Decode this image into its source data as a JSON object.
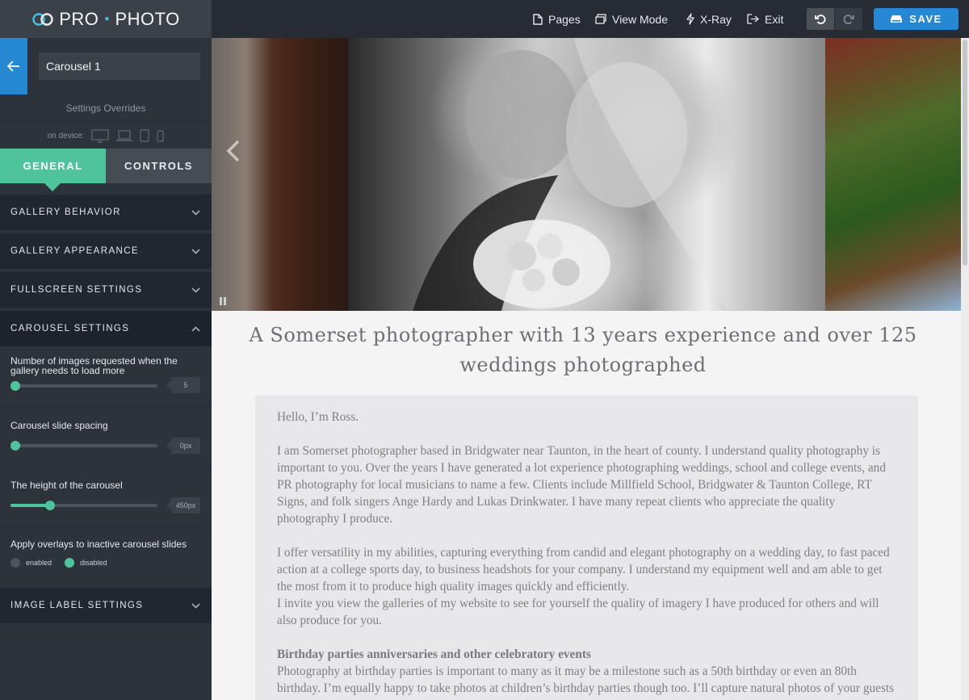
{
  "app": {
    "brand_left": "PRO",
    "brand_right": "PHOTO"
  },
  "toolbar": {
    "pages": "Pages",
    "view_mode": "View Mode",
    "xray": "X-Ray",
    "exit": "Exit",
    "save": "SAVE"
  },
  "sidebar": {
    "element_name": "Carousel 1",
    "settings_overrides": "Settings Overrides",
    "on_device": "on device:",
    "tabs": [
      "GENERAL",
      "CONTROLS"
    ],
    "sections": {
      "behavior": "GALLERY BEHAVIOR",
      "appearance": "GALLERY APPEARANCE",
      "fullscreen": "FULLSCREEN SETTINGS",
      "carousel": "CAROUSEL SETTINGS",
      "image_label": "IMAGE LABEL SETTINGS"
    },
    "controls": {
      "images_requested": {
        "label": "Number of images requested when the gallery needs to load more",
        "value": "5",
        "fraction": 0.0
      },
      "slide_spacing": {
        "label": "Carousel slide spacing",
        "value": "0px",
        "fraction": 0.0
      },
      "carousel_height": {
        "label": "The height of the carousel",
        "value": "450px",
        "fraction": 0.27
      },
      "overlays": {
        "label": "Apply overlays to inactive carousel slides",
        "option_enabled": "enabled",
        "option_disabled": "disabled",
        "selected": "disabled"
      }
    }
  },
  "preview": {
    "title": "A Somerset photographer with 13 years experience and over 125 weddings photographed",
    "paragraphs": [
      "Hello, I’m Ross.",
      "I am Somerset photographer based in Bridgwater  near Taunton, in the heart of county.  I understand quality photography is important to you.  Over the years I have generated a lot experience photographing weddings, school and college events, and PR photography for local musicians to name a few.  Clients include Millfield School, Bridgwater & Taunton College, RT Signs, and folk singers Ange Hardy and Lukas Drinkwater.  I have many repeat clients who appreciate the quality photography I produce.",
      "I offer versatility in my abilities, capturing everything from candid and elegant photography on a wedding day, to fast paced action at a college sports day, to business headshots for your company.  I understand my equipment well and am able to get the most from it to produce high quality images quickly and efficiently.",
      "I invite you view the galleries of my website to see for yourself the quality of imagery I have produced for others and will also produce for you."
    ],
    "subheading": "Birthday parties anniversaries and other celebratory events",
    "subparagraph": "Photography at birthday parties is important to many as it may be a milestone such as a 50th birthday or even an 80th birthday.  I’m equally happy to take photos at children’s birthday parties though too.  I’ll capture natural photos of your guests having fun.  You can use them for a personal record of the event, or for sharing on social media."
  },
  "colors": {
    "accent_green": "#4fc49c",
    "accent_blue": "#2688d2",
    "sidebar_bg": "#2d333b",
    "topbar_bg": "#272c34"
  }
}
